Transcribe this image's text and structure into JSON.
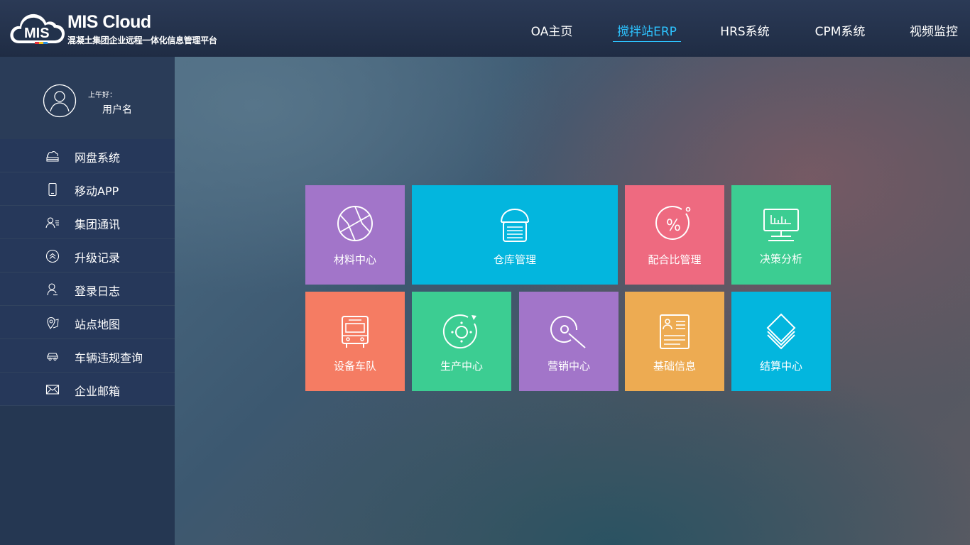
{
  "colors": {
    "accent": "#2dc3ff",
    "purple": "#a275c9",
    "cyan": "#03b6de",
    "pink": "#ee6a80",
    "green": "#3ccd92",
    "orange": "#f57c63",
    "yellow": "#edab52"
  },
  "header": {
    "brand": "MIS Cloud",
    "logo_badge": "MIS",
    "subtitle": "混凝土集团企业远程一体化信息管理平台",
    "nav": [
      {
        "label": "OA主页",
        "active": false
      },
      {
        "label": "搅拌站ERP",
        "active": true
      },
      {
        "label": "HRS系统",
        "active": false
      },
      {
        "label": "CPM系统",
        "active": false
      },
      {
        "label": "视频监控",
        "active": false
      }
    ]
  },
  "user": {
    "greeting": "上午好：",
    "name": "用户名",
    "icon": "user-avatar-icon"
  },
  "sidebar": {
    "items": [
      {
        "label": "网盘系统",
        "icon": "cloud-drive-icon"
      },
      {
        "label": "移动APP",
        "icon": "mobile-icon"
      },
      {
        "label": "集团通讯",
        "icon": "contacts-icon"
      },
      {
        "label": "升级记录",
        "icon": "upgrade-icon"
      },
      {
        "label": "登录日志",
        "icon": "login-log-icon"
      },
      {
        "label": "站点地图",
        "icon": "map-pin-icon"
      },
      {
        "label": "车辆违规查询",
        "icon": "car-icon"
      },
      {
        "label": "企业邮箱",
        "icon": "mail-icon"
      }
    ]
  },
  "tiles": [
    {
      "label": "材料中心",
      "icon": "aperture-icon",
      "color": "#a275c9"
    },
    {
      "label": "仓库管理",
      "icon": "warehouse-icon",
      "color": "#03b6de"
    },
    {
      "label": "配合比管理",
      "icon": "percent-icon",
      "color": "#ee6a80"
    },
    {
      "label": "决策分析",
      "icon": "monitor-chart-icon",
      "color": "#3ccd92"
    },
    {
      "label": "设备车队",
      "icon": "bus-icon",
      "color": "#f57c63"
    },
    {
      "label": "生产中心",
      "icon": "production-icon",
      "color": "#3ccd92"
    },
    {
      "label": "营销中心",
      "icon": "marketing-icon",
      "color": "#a275c9"
    },
    {
      "label": "基础信息",
      "icon": "profile-card-icon",
      "color": "#edab52"
    },
    {
      "label": "结算中心",
      "icon": "layers-icon",
      "color": "#03b6de"
    }
  ]
}
